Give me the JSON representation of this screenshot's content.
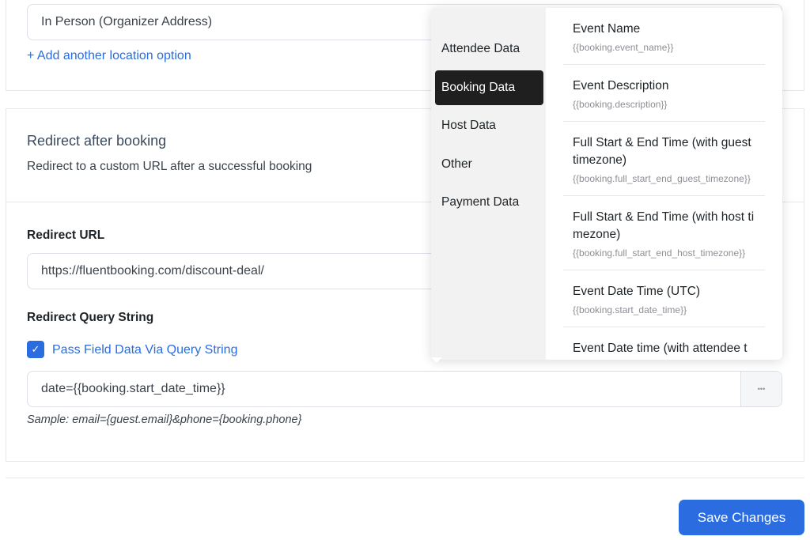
{
  "location": {
    "value": "In Person (Organizer Address)",
    "add_link": "+ Add another location option"
  },
  "redirect": {
    "title": "Redirect after booking",
    "description": "Redirect to a custom URL after a successful booking",
    "url_label": "Redirect URL",
    "url_value": "https://fluentbooking.com/discount-deal/",
    "query_label": "Redirect Query String",
    "pass_field_label": "Pass Field Data Via Query String",
    "pass_field_checked": true,
    "query_value": "date={{booking.start_date_time}}",
    "more_button": "•••",
    "sample": "Sample: email={guest.email}&phone={booking.phone}"
  },
  "save_button": "Save Changes",
  "popup": {
    "categories": [
      {
        "label": "Attendee Data"
      },
      {
        "label": "Booking Data",
        "active": true
      },
      {
        "label": "Host Data"
      },
      {
        "label": "Other"
      },
      {
        "label": "Payment Data"
      }
    ],
    "items": [
      {
        "title": "Event Name",
        "code": "{{booking.event_name}}"
      },
      {
        "title": "Event Description",
        "code": "{{booking.description}}"
      },
      {
        "title": "Full Start & End Time (with guest timezone)",
        "code": "{{booking.full_start_end_guest_timezone}}"
      },
      {
        "title": "Full Start & End Time (with host timezone)",
        "code": "{{booking.full_start_end_host_timezone}}"
      },
      {
        "title": "Event Date Time (UTC)",
        "code": "{{booking.start_date_time}}"
      },
      {
        "title": "Event Date time (with attendee t",
        "code": ""
      }
    ]
  },
  "colors": {
    "accent": "#2b6de0",
    "active_nav": "#1f1f1f"
  }
}
